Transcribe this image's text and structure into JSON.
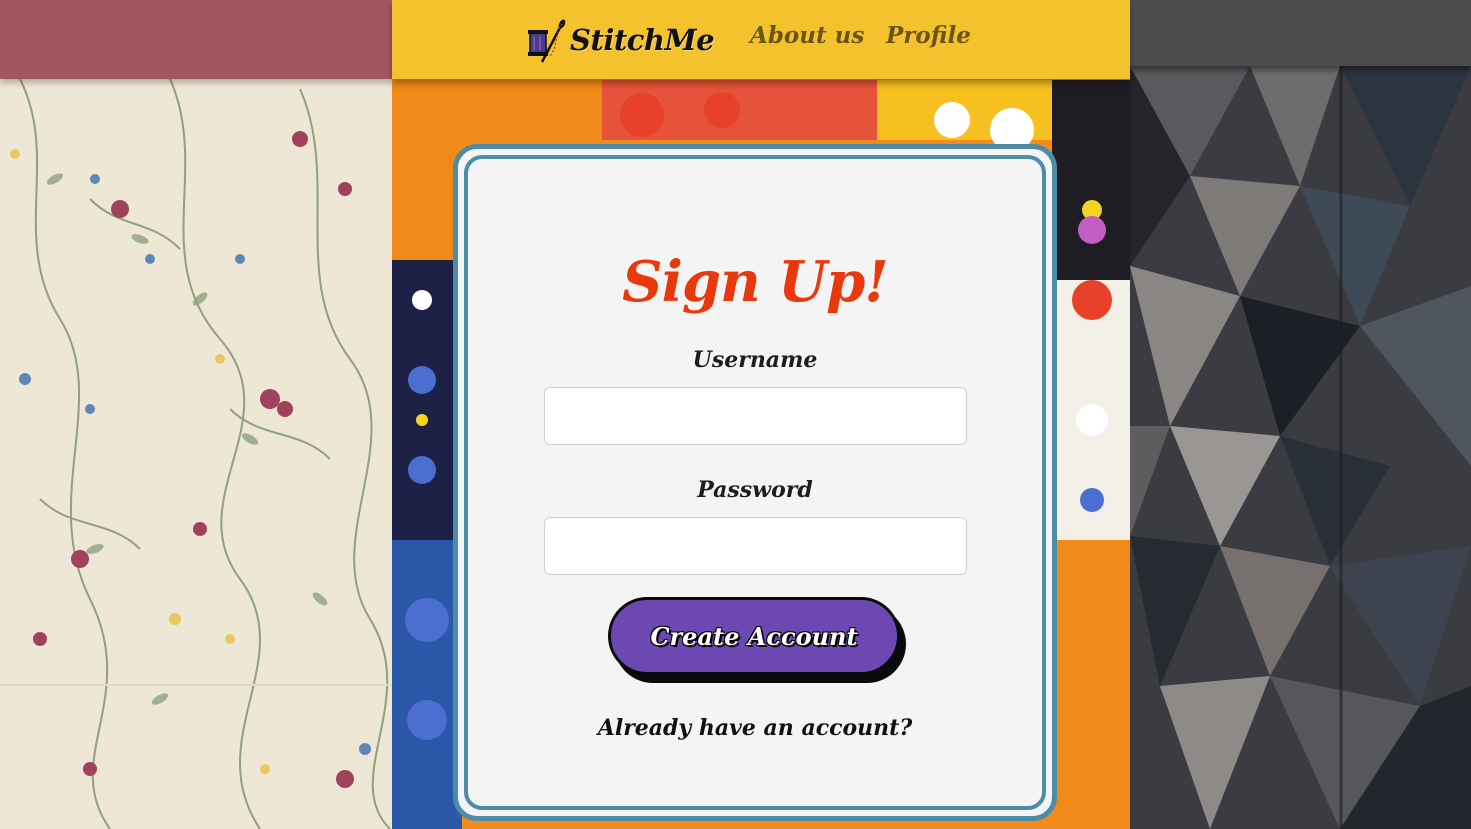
{
  "navbar": {
    "brand_name": "StitchMe",
    "brand_icon": "needle-and-thread-icon",
    "links": [
      {
        "label": "About us"
      },
      {
        "label": "Profile"
      }
    ],
    "color": "#f4c22c"
  },
  "signup": {
    "title": "Sign Up!",
    "username_label": "Username",
    "username_value": "",
    "password_label": "Password",
    "password_value": "",
    "submit_label": "Create Account",
    "login_link": "Already have an account?"
  },
  "colors": {
    "title": "#e8380c",
    "button": "#6d48b3",
    "card_border": "#4d8ba6",
    "left_bar": "#a15660",
    "right_bar": "#4e4c4b"
  }
}
